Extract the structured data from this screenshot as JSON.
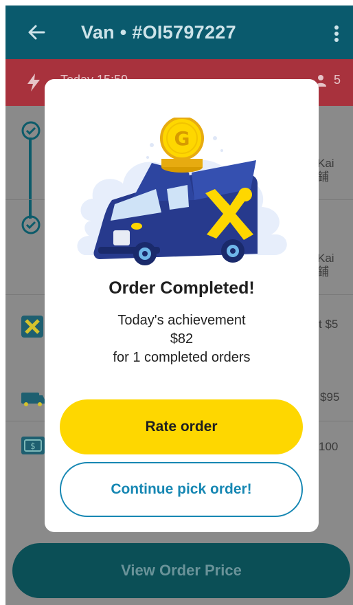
{
  "header": {
    "title": "Van • #OI5797227"
  },
  "banner": {
    "text": "Today 15:59",
    "passengers": "5"
  },
  "background": {
    "stop_side_1": "Kai\n鋪",
    "stop_side_2": "Kai\n鋪",
    "fee_1": "t $5",
    "fee_2": "$95",
    "fee_3": "100"
  },
  "bottom_button": {
    "label": "View Order Price"
  },
  "modal": {
    "coin_letter": "G",
    "title": "Order Completed!",
    "line1": "Today's achievement",
    "amount": "$82",
    "line3": "for 1 completed orders",
    "rate_label": "Rate order",
    "continue_label": "Continue pick order!"
  },
  "colors": {
    "header": "#0a5a6d",
    "banner": "#a8323d",
    "primary_yellow": "#fed700",
    "accent_blue": "#1687b3"
  }
}
